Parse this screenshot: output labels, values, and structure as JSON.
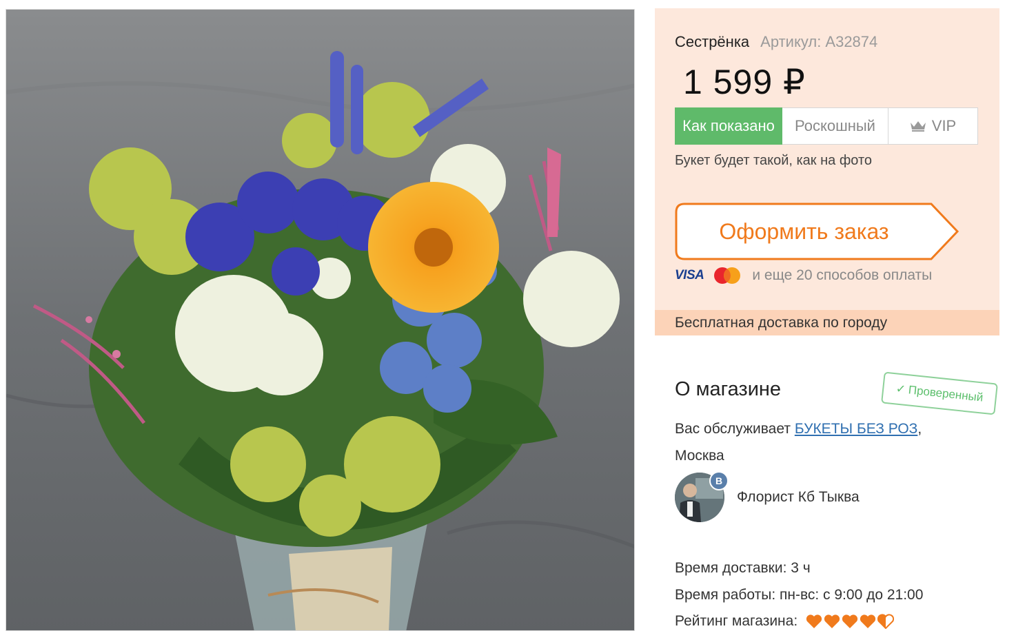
{
  "product": {
    "name": "Сестрёнка",
    "sku": "Артикул: А32874",
    "price": "1 599 ₽",
    "options": [
      {
        "label": "Как показано",
        "active": true
      },
      {
        "label": "Роскошный",
        "active": false
      },
      {
        "label": "VIP",
        "active": false
      }
    ],
    "option_note": "Букет будет такой, как на фото",
    "order_button": "Оформить заказ",
    "payment": {
      "visa": "VISA",
      "mastercard": "MasterCard",
      "more": "и еще 20 способов оплаты"
    },
    "free_delivery": "Бесплатная доставка по городу"
  },
  "shop": {
    "title": "О магазине",
    "verified_stamp": "Проверенный",
    "served_prefix": "Вас обслуживает",
    "shop_name": "БУКЕТЫ БЕЗ РОЗ",
    "served_suffix": ",",
    "city": "Москва",
    "florist_badge": "B",
    "florist_name": "Флорист Кб Тыква",
    "delivery_time": "Время доставки: 3 ч",
    "work_hours": "Время работы: пн-вс: с 9:00 до 21:00",
    "rating_label": "Рейтинг магазина:",
    "rating": 4.5,
    "rating_max": 5
  },
  "colors": {
    "accent_orange": "#f07a1c",
    "active_green": "#5fba6a",
    "panel_bg": "#fde8dc",
    "link_blue": "#2f6fb0"
  }
}
